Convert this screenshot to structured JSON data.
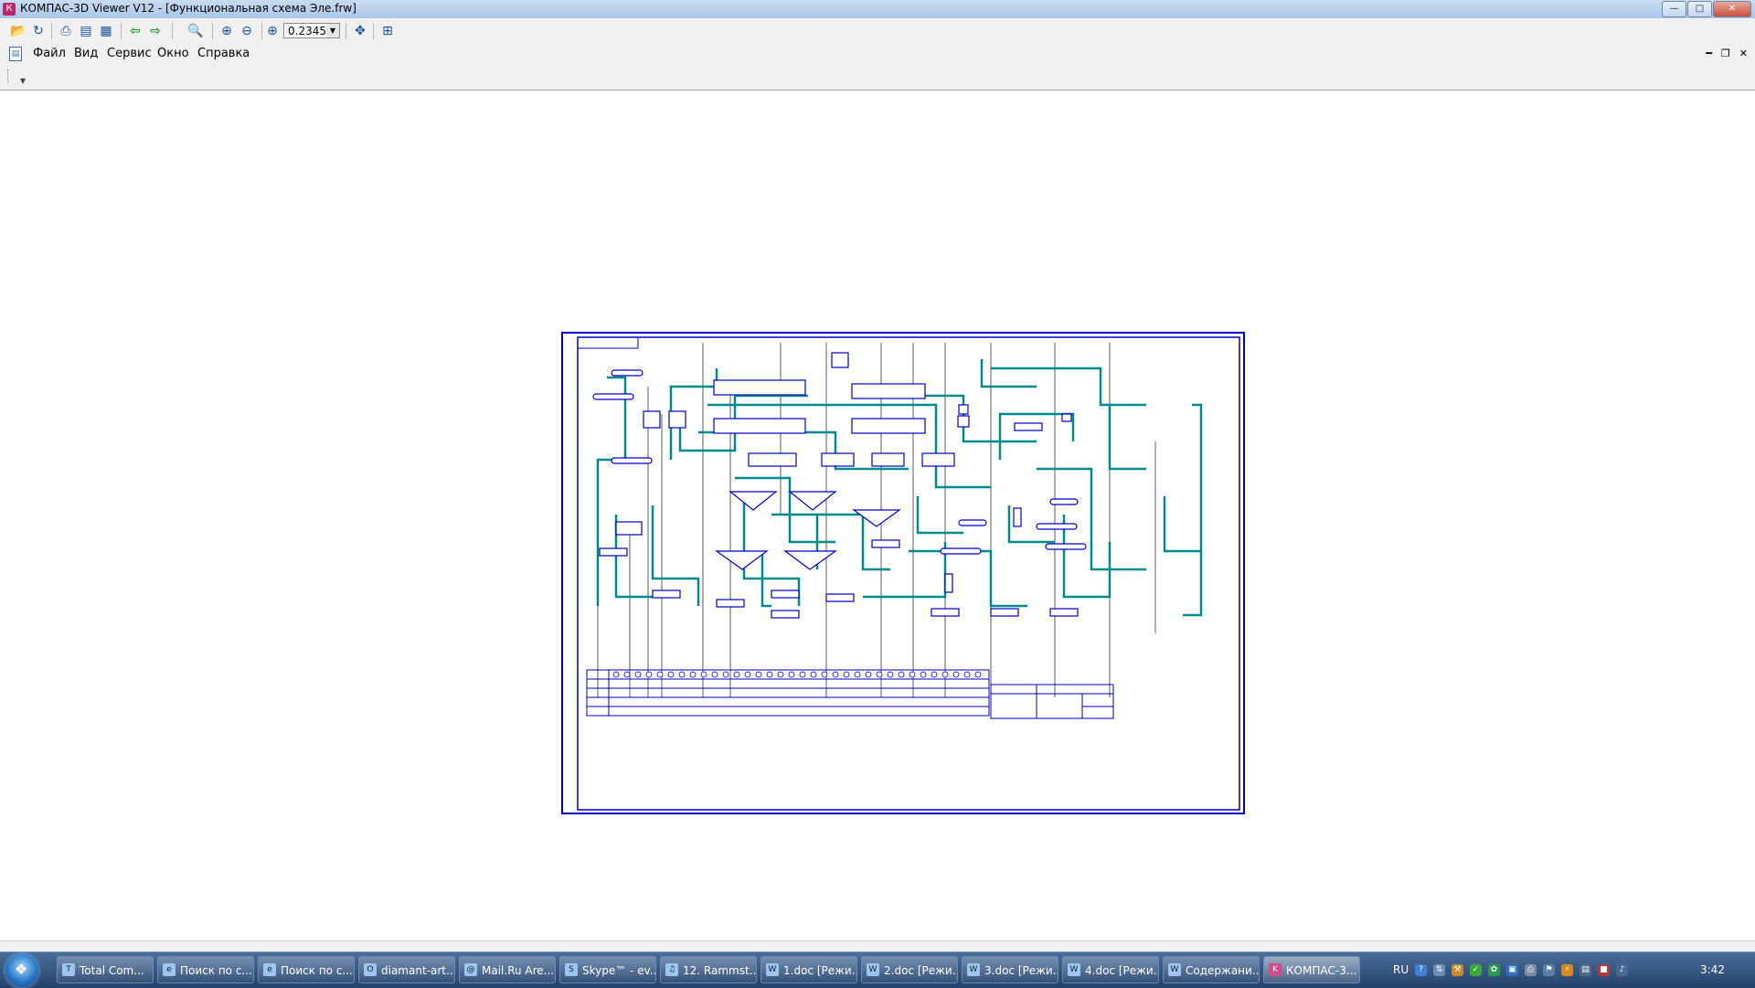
{
  "window": {
    "title": "КОМПАС-3D Viewer V12 - [Функциональная схема Эле.frw]",
    "minimize_icon": "minimize-icon",
    "maximize_icon": "maximize-icon",
    "close_icon": "close-icon"
  },
  "toolbar": {
    "zoom_value": "0.2345",
    "icons": [
      "open-icon",
      "reload-icon",
      "print-icon",
      "print-preview-icon",
      "export-icon",
      "back-arrow-icon",
      "forward-arrow-icon",
      "zoom-icon",
      "zoom-in-icon",
      "zoom-out-icon",
      "zoom-scale-icon",
      "pan-icon",
      "refresh-view-icon"
    ],
    "accent_green": "#1f9a2f",
    "accent_blue": "#1b4f9a"
  },
  "menu": {
    "items": [
      "Файл",
      "Вид",
      "Сервис",
      "Окно",
      "Справка"
    ]
  },
  "drawing": {
    "line_color_main": "#0000cc",
    "line_color_pipe": "#008a8a"
  },
  "taskbar": {
    "items": [
      {
        "label": "Total Com...",
        "icon": "total-commander-icon"
      },
      {
        "label": "Поиск по с...",
        "icon": "ie-icon"
      },
      {
        "label": "Поиск по с...",
        "icon": "ie-icon"
      },
      {
        "label": "diamant-art...",
        "icon": "opera-icon"
      },
      {
        "label": "Mail.Ru Are...",
        "icon": "mail-icon"
      },
      {
        "label": "Skype™ - ev...",
        "icon": "skype-icon"
      },
      {
        "label": "12. Rammst...",
        "icon": "winamp-icon"
      },
      {
        "label": "1.doc [Режи...",
        "icon": "word-icon"
      },
      {
        "label": "2.doc [Режи...",
        "icon": "word-icon"
      },
      {
        "label": "3.doc [Режи...",
        "icon": "word-icon"
      },
      {
        "label": "4.doc [Режи...",
        "icon": "word-icon"
      },
      {
        "label": "Содержани...",
        "icon": "word-icon"
      },
      {
        "label": "КОМПАС-3...",
        "icon": "kompas-icon"
      }
    ],
    "lang": "RU",
    "clock": "3:42"
  }
}
